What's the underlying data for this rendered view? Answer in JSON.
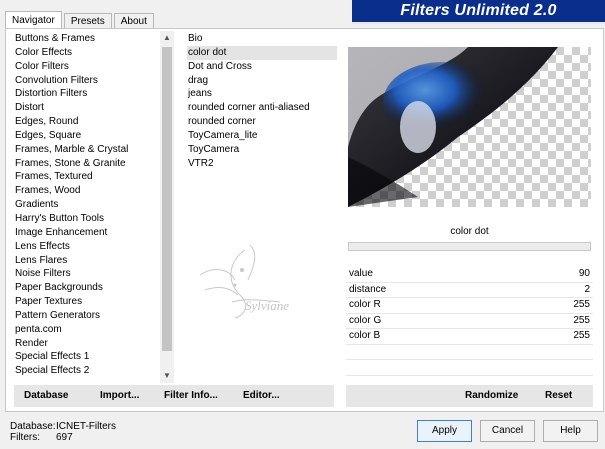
{
  "tabs": [
    {
      "label": "Navigator",
      "active": true
    },
    {
      "label": "Presets",
      "active": false
    },
    {
      "label": "About",
      "active": false
    }
  ],
  "banner": "Filters Unlimited 2.0",
  "categories": [
    "Buttons & Frames",
    "Color Effects",
    "Color Filters",
    "Convolution Filters",
    "Distortion Filters",
    "Distort",
    "Edges, Round",
    "Edges, Square",
    "Frames, Marble & Crystal",
    "Frames, Stone & Granite",
    "Frames, Textured",
    "Frames, Wood",
    "Gradients",
    "Harry's Button Tools",
    "Image Enhancement",
    "Lens Effects",
    "Lens Flares",
    "Noise Filters",
    "Paper Backgrounds",
    "Paper Textures",
    "Pattern Generators",
    "penta.com",
    "Render",
    "Special Effects 1",
    "Special Effects 2"
  ],
  "filters": [
    {
      "label": "Bio"
    },
    {
      "label": "color dot",
      "selected": true
    },
    {
      "label": "Dot and Cross"
    },
    {
      "label": "drag"
    },
    {
      "label": "jeans"
    },
    {
      "label": "rounded corner anti-aliased"
    },
    {
      "label": "rounded corner"
    },
    {
      "label": "ToyCamera_lite"
    },
    {
      "label": "ToyCamera"
    },
    {
      "label": "VTR2"
    }
  ],
  "filter_name": "color dot",
  "params": [
    {
      "name": "value",
      "value": "90"
    },
    {
      "name": "distance",
      "value": "2"
    },
    {
      "name": "color R",
      "value": "255"
    },
    {
      "name": "color G",
      "value": "255"
    },
    {
      "name": "color B",
      "value": "255"
    }
  ],
  "left_buttons": {
    "database": "Database",
    "import": "Import...",
    "filter_info": "Filter Info...",
    "editor": "Editor..."
  },
  "right_buttons": {
    "randomize": "Randomize",
    "reset": "Reset"
  },
  "status": {
    "database_label": "Database:",
    "database_value": "ICNET-Filters",
    "filters_label": "Filters:",
    "filters_value": "697"
  },
  "dialog_buttons": {
    "apply": "Apply",
    "cancel": "Cancel",
    "help": "Help"
  },
  "watermark_text": "Sylviane"
}
